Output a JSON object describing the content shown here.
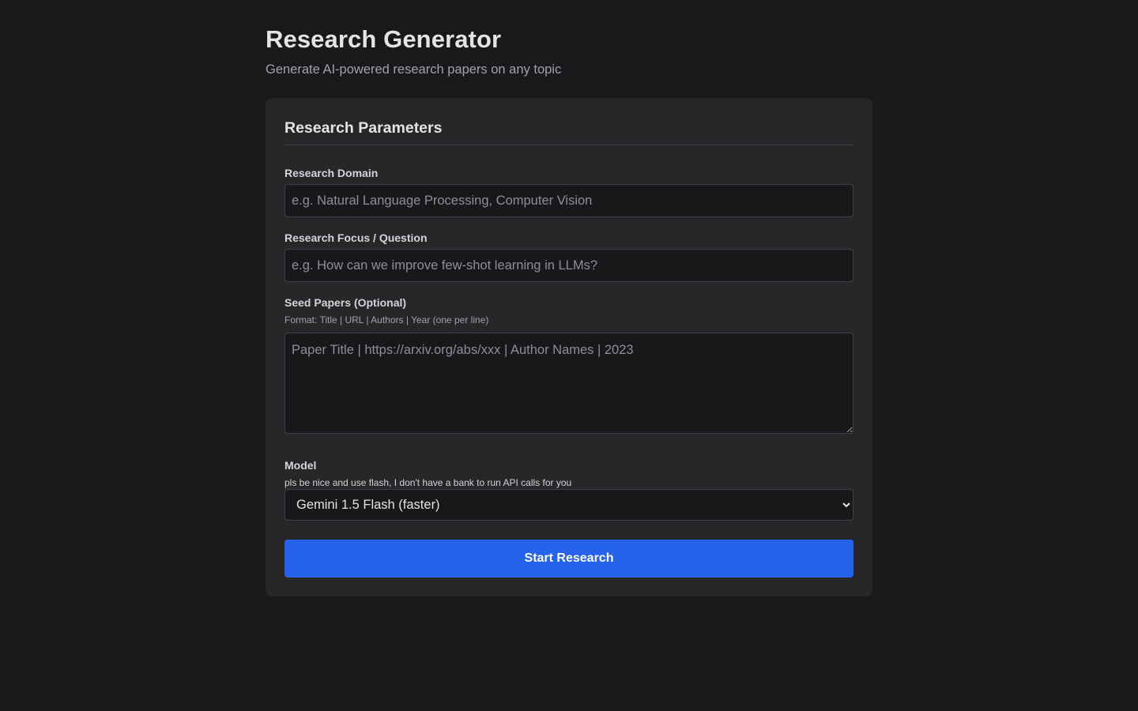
{
  "header": {
    "title": "Research Generator",
    "subtitle": "Generate AI-powered research papers on any topic"
  },
  "form": {
    "section_title": "Research Parameters",
    "domain": {
      "label": "Research Domain",
      "placeholder": "e.g. Natural Language Processing, Computer Vision",
      "value": ""
    },
    "focus": {
      "label": "Research Focus / Question",
      "placeholder": "e.g. How can we improve few-shot learning in LLMs?",
      "value": ""
    },
    "seed_papers": {
      "label": "Seed Papers (Optional)",
      "hint": "Format: Title | URL | Authors | Year (one per line)",
      "placeholder": "Paper Title | https://arxiv.org/abs/xxx | Author Names | 2023",
      "value": ""
    },
    "model": {
      "label": "Model",
      "hint": "pls be nice and use flash, I don't have a bank to run API calls for you",
      "selected": "Gemini 1.5 Flash (faster)"
    },
    "submit_label": "Start Research"
  },
  "colors": {
    "background": "#19191c",
    "card": "#27272a",
    "input": "#18181b",
    "accent": "#2563eb"
  }
}
